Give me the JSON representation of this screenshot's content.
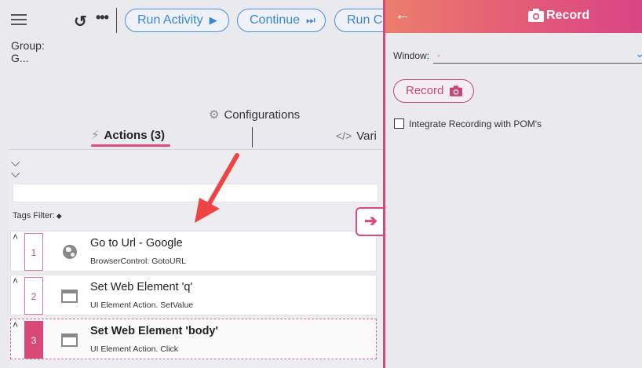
{
  "toolbar": {
    "menu_icon": "hamburger-icon",
    "undo_icon": "undo-icon",
    "more_icon": "more-icon",
    "more_label": "•••",
    "run_activity_label": "Run Activity",
    "run_activity_icon": "▶",
    "continue_label": "Continue",
    "continue_icon": "⏭",
    "run_current_label": "Run C"
  },
  "group": {
    "label": "Group: G..."
  },
  "configurations": {
    "label": "Configurations",
    "icon": "gear-icon"
  },
  "tabs": {
    "actions": {
      "label": "Actions (3)",
      "icon": "bolt-icon"
    },
    "variables": {
      "label": "Vari",
      "icon": "code-icon"
    }
  },
  "actions_panel": {
    "collapse_icon": "double-chevron-down-icon",
    "tags_filter_label": "Tags Filter:",
    "tag_icon": "tag-icon",
    "items": [
      {
        "number": "1",
        "title": "Go to Url - Google",
        "subtitle": "BrowserControl: GotoURL",
        "icon": "globe-icon"
      },
      {
        "number": "2",
        "title": "Set Web Element 'q'",
        "subtitle": "UI Element Action. SetValue",
        "icon": "window-icon"
      },
      {
        "number": "3",
        "title": "Set Web Element 'body'",
        "subtitle": "UI Element Action. Click",
        "icon": "window-icon"
      }
    ]
  },
  "expand_handle": {
    "icon": "arrow-right-icon",
    "glyph": "➔"
  },
  "record_panel": {
    "title": "Record",
    "back_icon": "arrow-left-icon",
    "window_label": "Window:",
    "window_value": "-",
    "record_button_label": "Record",
    "pom_label": "Integrate Recording with POM's",
    "pom_checked": false
  },
  "colors": {
    "accent_pink": "#d94a7e",
    "accent_blue": "#3b86d1",
    "header_gradient_start": "#eb7e6c",
    "header_gradient_end": "#d94484",
    "annotation_arrow": "#ef4444"
  }
}
